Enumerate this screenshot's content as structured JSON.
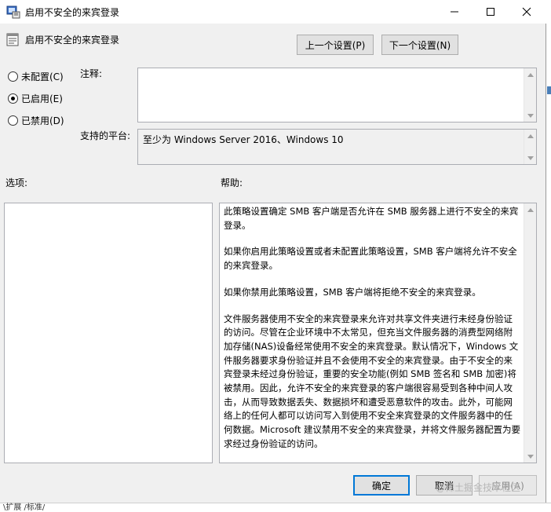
{
  "window": {
    "title": "启用不安全的来宾登录",
    "header": "启用不安全的来宾登录"
  },
  "nav": {
    "prev_label": "上一个设置(P)",
    "next_label": "下一个设置(N)"
  },
  "radios": [
    {
      "label": "未配置(C)",
      "selected": false
    },
    {
      "label": "已启用(E)",
      "selected": true
    },
    {
      "label": "已禁用(D)",
      "selected": false
    }
  ],
  "comment": {
    "label": "注释:",
    "value": ""
  },
  "platform": {
    "label": "支持的平台:",
    "value": "至少为 Windows Server 2016、Windows 10"
  },
  "options": {
    "label": "选项:"
  },
  "help": {
    "label": "帮助:",
    "paragraphs": [
      "此策略设置确定 SMB 客户端是否允许在 SMB 服务器上进行不安全的来宾登录。",
      "如果你启用此策略设置或者未配置此策略设置，SMB 客户端将允许不安全的来宾登录。",
      "如果你禁用此策略设置，SMB 客户端将拒绝不安全的来宾登录。",
      "文件服务器使用不安全的来宾登录来允许对共享文件夹进行未经身份验证的访问。尽管在企业环境中不太常见，但充当文件服务器的消费型网络附加存储(NAS)设备经常使用不安全的来宾登录。默认情况下，Windows 文件服务器要求身份验证并且不会使用不安全的来宾登录。由于不安全的来宾登录未经过身份验证，重要的安全功能(例如 SMB 签名和 SMB 加密)将被禁用。因此，允许不安全的来宾登录的客户端很容易受到各种中间人攻击，从而导致数据丢失、数据损坏和遭受恶意软件的攻击。此外，可能网络上的任何人都可以访问写入到使用不安全来宾登录的文件服务器中的任何数据。Microsoft 建议禁用不安全的来宾登录，并将文件服务器配置为要求经过身份验证的访问。"
    ]
  },
  "footer": {
    "ok_label": "确定",
    "cancel_label": "取消",
    "apply_label": "应用(A)"
  },
  "background": {
    "tabs_text": "\\扩展 /标准/",
    "watermark": "@稀土掘金技术社区"
  }
}
